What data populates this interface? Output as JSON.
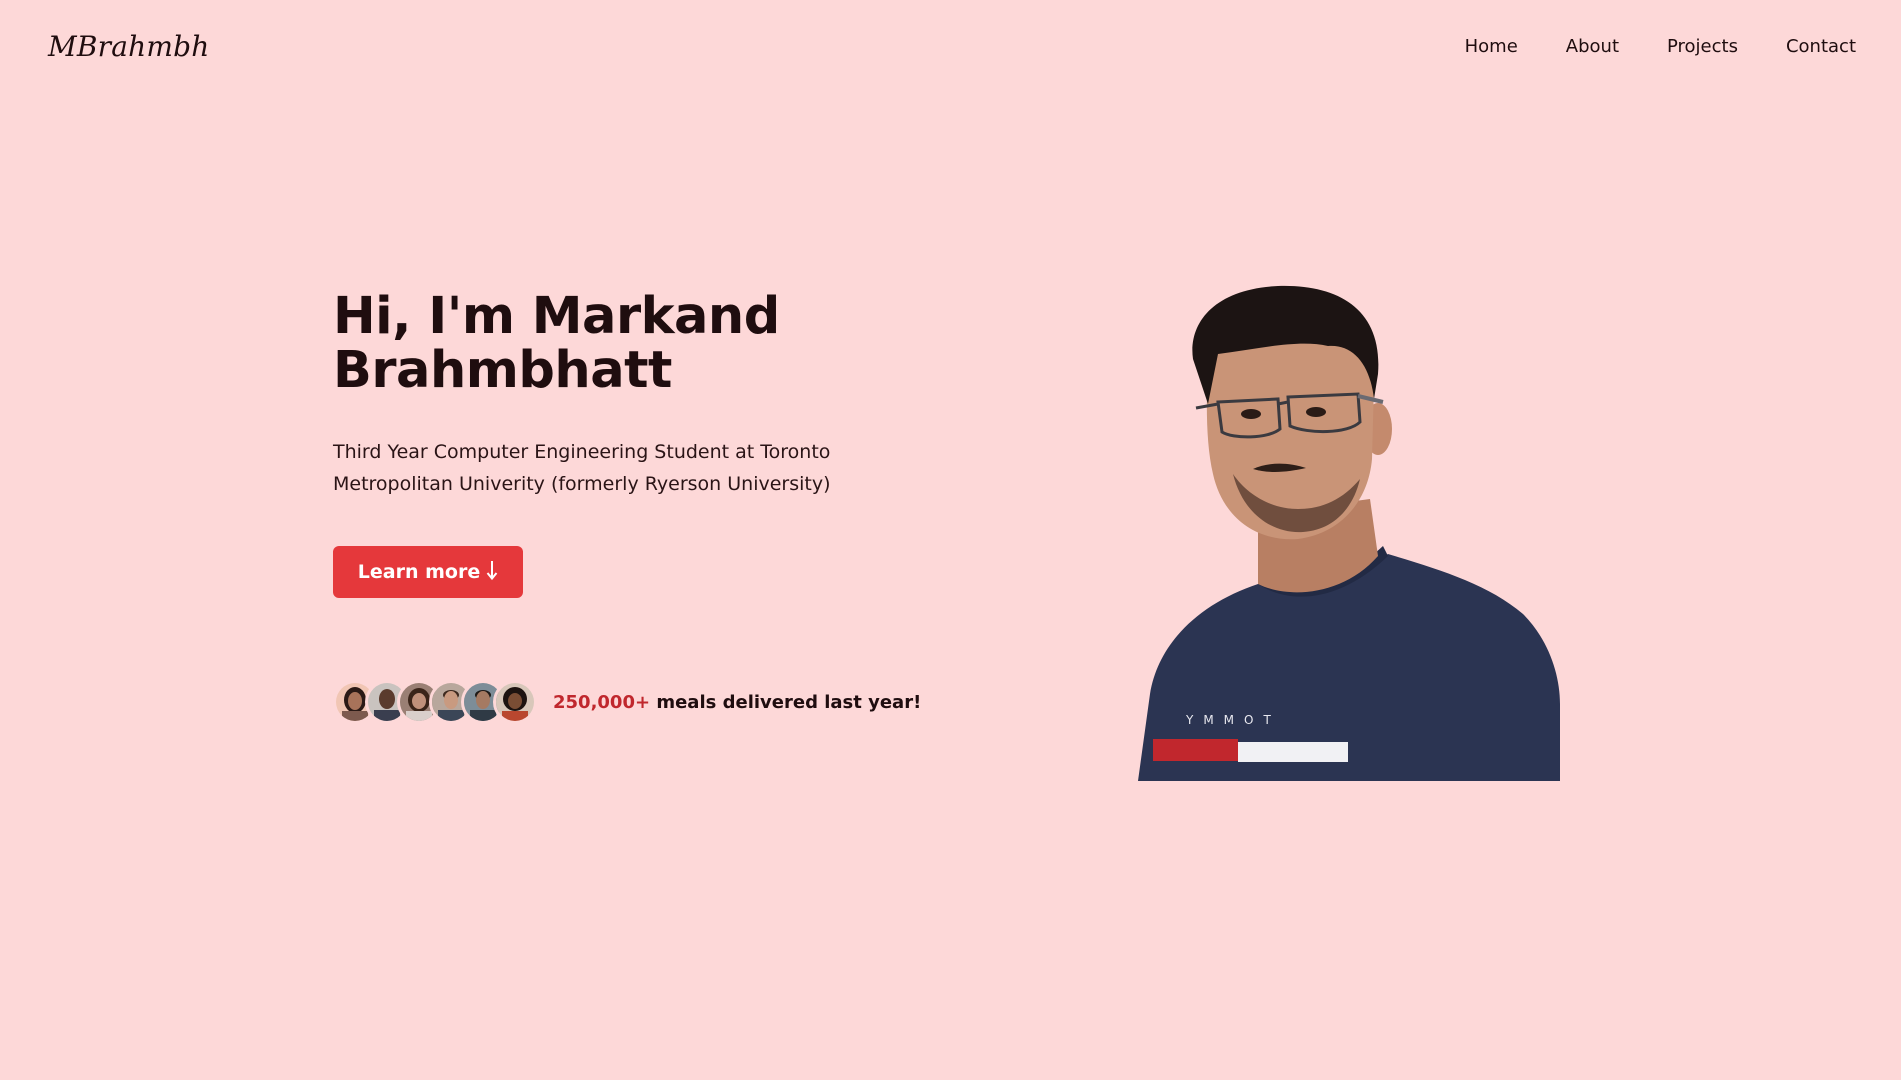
{
  "brand": {
    "logo_text": "MBrahmbh"
  },
  "nav": {
    "items": [
      {
        "label": "Home"
      },
      {
        "label": "About"
      },
      {
        "label": "Projects"
      },
      {
        "label": "Contact"
      }
    ]
  },
  "hero": {
    "title_line1": "Hi, I'm Markand",
    "title_line2": "Brahmbhatt",
    "subtitle": "Third Year Computer Engineering Student at Toronto Metropolitan Univerity (formerly Ryerson University)",
    "cta_label": "Learn more",
    "cta_icon": "arrow-down-icon",
    "social_proof": {
      "count": "250,000+",
      "text": " meals delivered last year!",
      "avatar_count": 6
    }
  },
  "colors": {
    "background": "#fdd8d8",
    "accent": "#e5383b",
    "highlight": "#c0272d",
    "text": "#1f0d0f"
  }
}
